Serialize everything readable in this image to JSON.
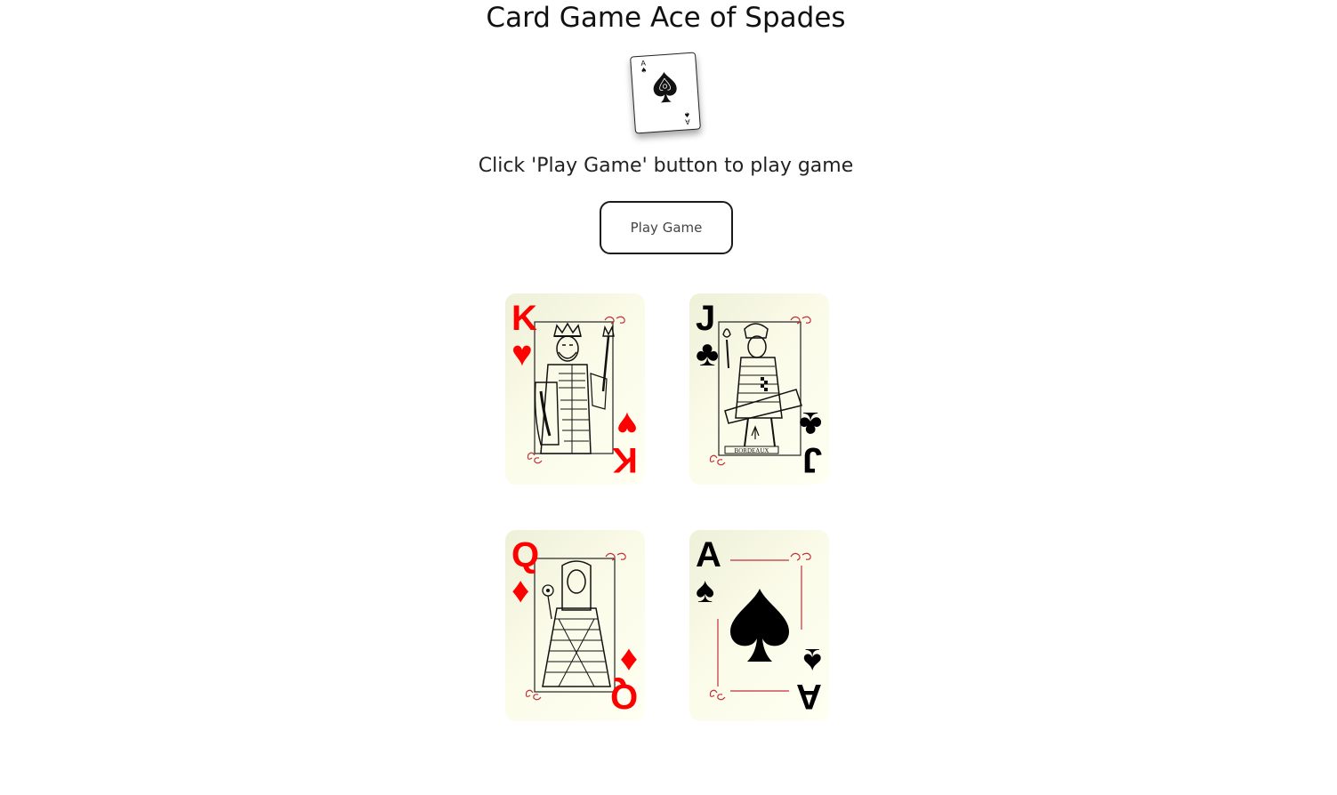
{
  "page": {
    "title": "Card Game Ace of Spades",
    "instruction": "Click 'Play Game' button to play game",
    "play_button_label": "Play Game"
  },
  "logo": {
    "rank": "A",
    "suit": "spade-icon"
  },
  "cards": [
    {
      "rank": "K",
      "suit": "hearts",
      "suit_symbol": "♥",
      "color": "#ff0000",
      "figure": "king-figure"
    },
    {
      "rank": "J",
      "suit": "clubs",
      "suit_symbol": "♣",
      "color": "#000000",
      "figure": "jack-figure"
    },
    {
      "rank": "Q",
      "suit": "diamonds",
      "suit_symbol": "♦",
      "color": "#ff0000",
      "figure": "queen-figure"
    },
    {
      "rank": "A",
      "suit": "spades",
      "suit_symbol": "♠",
      "color": "#000000",
      "figure": "large-spade"
    }
  ],
  "colors": {
    "card_face": "#fbfbe9",
    "frame_red": "#c0303a",
    "button_border": "#1a1a1a"
  }
}
